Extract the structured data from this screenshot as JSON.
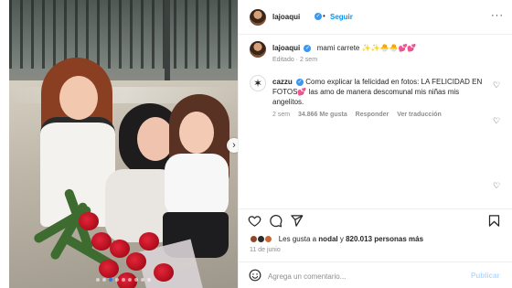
{
  "post": {
    "username": "lajoaqui",
    "follow_label": "Seguir",
    "separator": "•",
    "more_label": "···"
  },
  "caption": {
    "username": "lajoaqui",
    "text": "mami carrete ✨✨🐣🐣💕💕",
    "edited": "Editado · 2 sem"
  },
  "comment": {
    "username": "cazzu",
    "text_part1": "Como explicar la felicidad en fotos: LA FELICIDAD EN FOTOS",
    "heart": "💕",
    "text_part2": " las amo de manera descomunal mis niñas mis angelitos.",
    "time": "2 sem",
    "likes": "34.866 Me gusta",
    "reply": "Responder",
    "translate": "Ver traducción"
  },
  "likes": {
    "prefix": "Les gusta a ",
    "user": "nodal",
    "connector": " y ",
    "count": "820.013 personas más"
  },
  "date": "11 de junio",
  "comment_box": {
    "placeholder": "Agrega un comentario...",
    "publish": "Publicar"
  },
  "carousel": {
    "total": 9,
    "active": 2
  },
  "icons": [
    "heart-icon",
    "comment-icon",
    "share-icon",
    "bookmark-icon",
    "emoji-icon",
    "more-icon",
    "next-arrow-icon"
  ],
  "colors": {
    "accent": "#0095f6",
    "verified": "#3897f0",
    "muted": "#8e8e8e",
    "active_dot": "#2f7ae5"
  }
}
